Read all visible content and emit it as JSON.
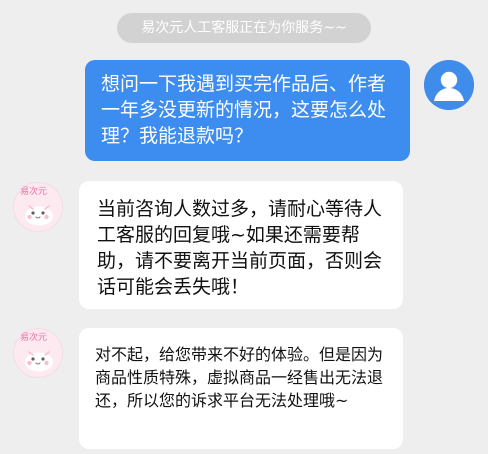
{
  "header": {
    "status_text": "易次元人工客服正在为你服务~~"
  },
  "conversation": {
    "user_message": {
      "text": "想问一下我遇到买完作品后、作者一年多没更新的情况，这要怎么处理？我能退款吗？"
    },
    "agent_messages": [
      {
        "text": "当前咨询人数过多，请耐心等待人工客服的回复哦~如果还需要帮助，请不要离开当前页面，否则会话可能会丢失哦！",
        "avatar_logo": "易次元"
      },
      {
        "text": "对不起，给您带来不好的体验。但是因为商品性质特殊，虚拟商品一经售出无法退还，所以您的诉求平台无法处理哦~",
        "avatar_logo": "易次元"
      }
    ]
  },
  "colors": {
    "background": "#eeeeee",
    "status_chip": "#d2d2d2",
    "user_bubble": "#3d8cef",
    "agent_bubble": "#ffffff",
    "agent_avatar_accent": "#ef6fa4"
  },
  "icons": {
    "user_avatar": "user-icon",
    "agent_avatar": "mascot-icon"
  }
}
